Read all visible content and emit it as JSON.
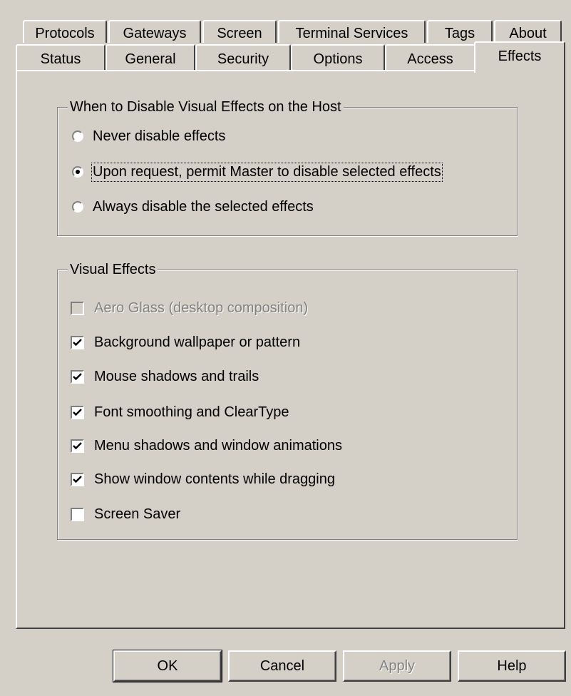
{
  "tabs": {
    "row1": [
      "Protocols",
      "Gateways",
      "Screen",
      "Terminal Services",
      "Tags",
      "About"
    ],
    "row2": [
      "Status",
      "General",
      "Security",
      "Options",
      "Access",
      "Effects"
    ],
    "active": "Effects"
  },
  "disable_group": {
    "title": "When to Disable Visual Effects on the Host",
    "options": [
      {
        "label": "Never disable effects",
        "checked": false
      },
      {
        "label": "Upon request, permit Master to disable selected effects",
        "checked": true
      },
      {
        "label": "Always disable the selected effects",
        "checked": false
      }
    ]
  },
  "effects_group": {
    "title": "Visual Effects",
    "items": [
      {
        "label": "Aero Glass (desktop composition)",
        "checked": false,
        "disabled": true
      },
      {
        "label": "Background wallpaper or pattern",
        "checked": true,
        "disabled": false
      },
      {
        "label": "Mouse shadows and trails",
        "checked": true,
        "disabled": false
      },
      {
        "label": "Font smoothing and ClearType",
        "checked": true,
        "disabled": false
      },
      {
        "label": "Menu shadows and window animations",
        "checked": true,
        "disabled": false
      },
      {
        "label": "Show window contents while dragging",
        "checked": true,
        "disabled": false
      },
      {
        "label": "Screen Saver",
        "checked": false,
        "disabled": false
      }
    ]
  },
  "buttons": {
    "ok": "OK",
    "cancel": "Cancel",
    "apply": "Apply",
    "help": "Help"
  },
  "colors": {
    "face": "#d4d0c8",
    "shadow": "#808080",
    "highlight": "#ffffff",
    "dark_shadow": "#404040"
  }
}
